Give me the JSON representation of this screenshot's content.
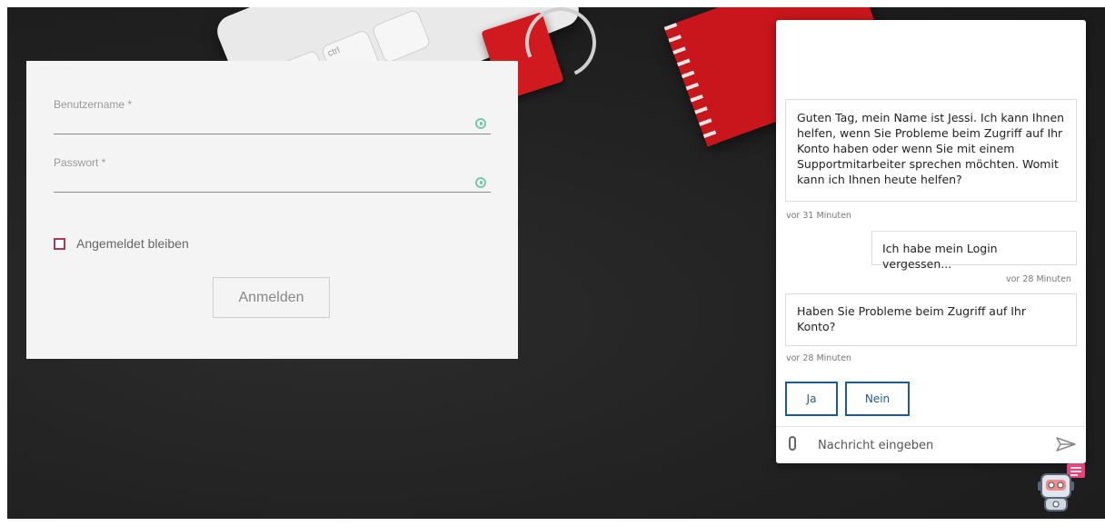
{
  "login": {
    "username_label": "Benutzername *",
    "password_label": "Passwort *",
    "remember_label": "Angemeldet bleiben",
    "submit_label": "Anmelden"
  },
  "desk": {
    "key1": "fn",
    "key2": "ctrl"
  },
  "chat": {
    "messages": [
      {
        "from": "bot",
        "text": "Guten Tag, mein Name ist Jessi. Ich kann Ihnen helfen, wenn Sie Probleme beim Zugriff auf Ihr Konto haben oder wenn Sie mit einem Supportmitarbeiter sprechen möchten. Womit kann ich Ihnen heute helfen?",
        "time": "vor 31 Minuten"
      },
      {
        "from": "user",
        "text": "Ich habe mein Login vergessen...",
        "time": "vor 28 Minuten"
      },
      {
        "from": "bot",
        "text": "Haben Sie Probleme beim Zugriff auf Ihr Konto?",
        "time": "vor 28 Minuten"
      }
    ],
    "choices": [
      "Ja",
      "Nein"
    ],
    "input_placeholder": "Nachricht eingeben",
    "accent_color": "#1f5a8c"
  },
  "icons": {
    "attach": "paperclip-icon",
    "send": "send-icon",
    "bot": "chatbot-avatar-icon",
    "key": "password-manager-key-icon"
  }
}
